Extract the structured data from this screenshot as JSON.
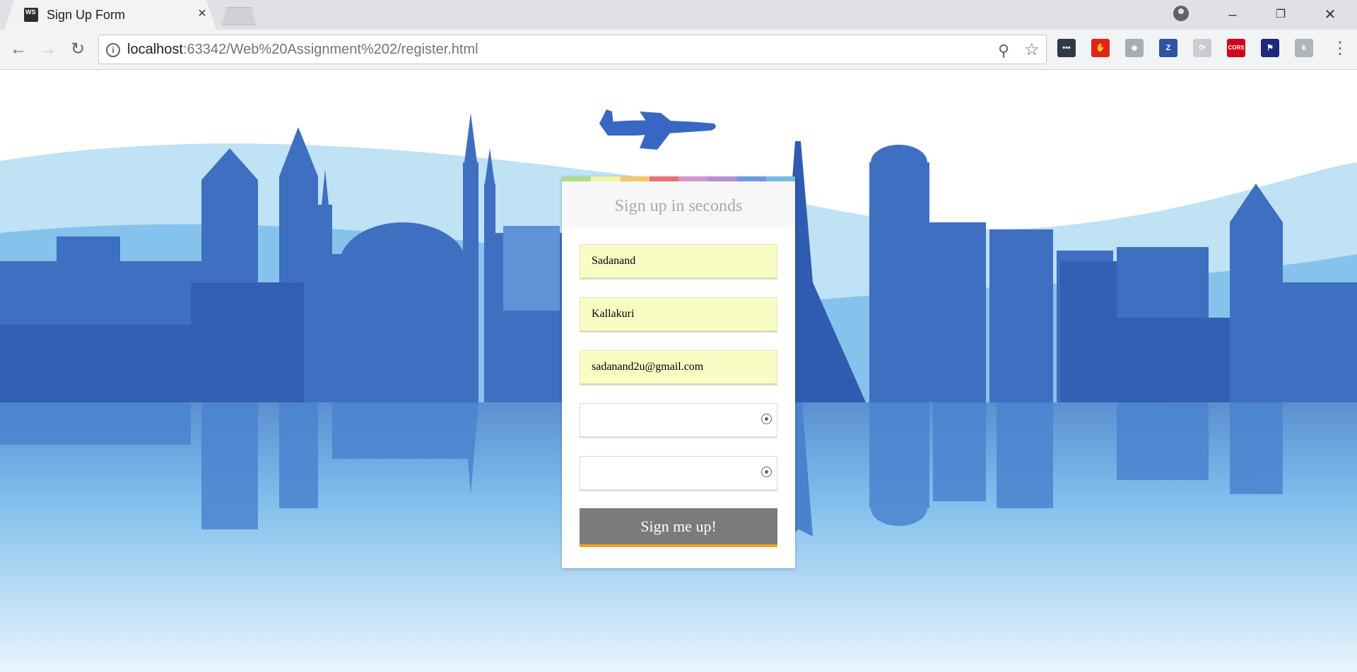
{
  "browser": {
    "tab_title": "Sign Up Form",
    "favicon_text": "WS",
    "url_host": "localhost",
    "url_rest": ":63342/Web%20Assignment%202/register.html",
    "extensions": [
      {
        "name": "ext-dashlane-icon",
        "text": "•••",
        "color": "#2e3a46"
      },
      {
        "name": "ext-adblock-icon",
        "text": "✋",
        "color": "#e2231a"
      },
      {
        "name": "ext-shield-icon",
        "text": "◆",
        "color": "#a8adb3"
      },
      {
        "name": "ext-zotero-icon",
        "text": "Z",
        "color": "#2f54a6"
      },
      {
        "name": "ext-swirl-icon",
        "text": "⟳",
        "color": "#c9ccd1"
      },
      {
        "name": "ext-cors-icon",
        "text": "CORS",
        "color": "#d0021b"
      },
      {
        "name": "ext-flag-icon",
        "text": "⚑",
        "color": "#1d2a7a"
      },
      {
        "name": "ext-grey-icon",
        "text": "k",
        "color": "#b0b3b8"
      }
    ]
  },
  "form": {
    "title": "Sign up in seconds",
    "first_name": "Sadanand",
    "last_name": "Kallakuri",
    "email": "sadanand2u@gmail.com",
    "password": "",
    "confirm_password": "",
    "submit_label": "Sign me up!",
    "stripe_colors": [
      "#b5d98b",
      "#f5f4a8",
      "#f4c86a",
      "#e8707a",
      "#d097c8",
      "#b48fd4",
      "#6f9ae0",
      "#74bde0"
    ]
  }
}
